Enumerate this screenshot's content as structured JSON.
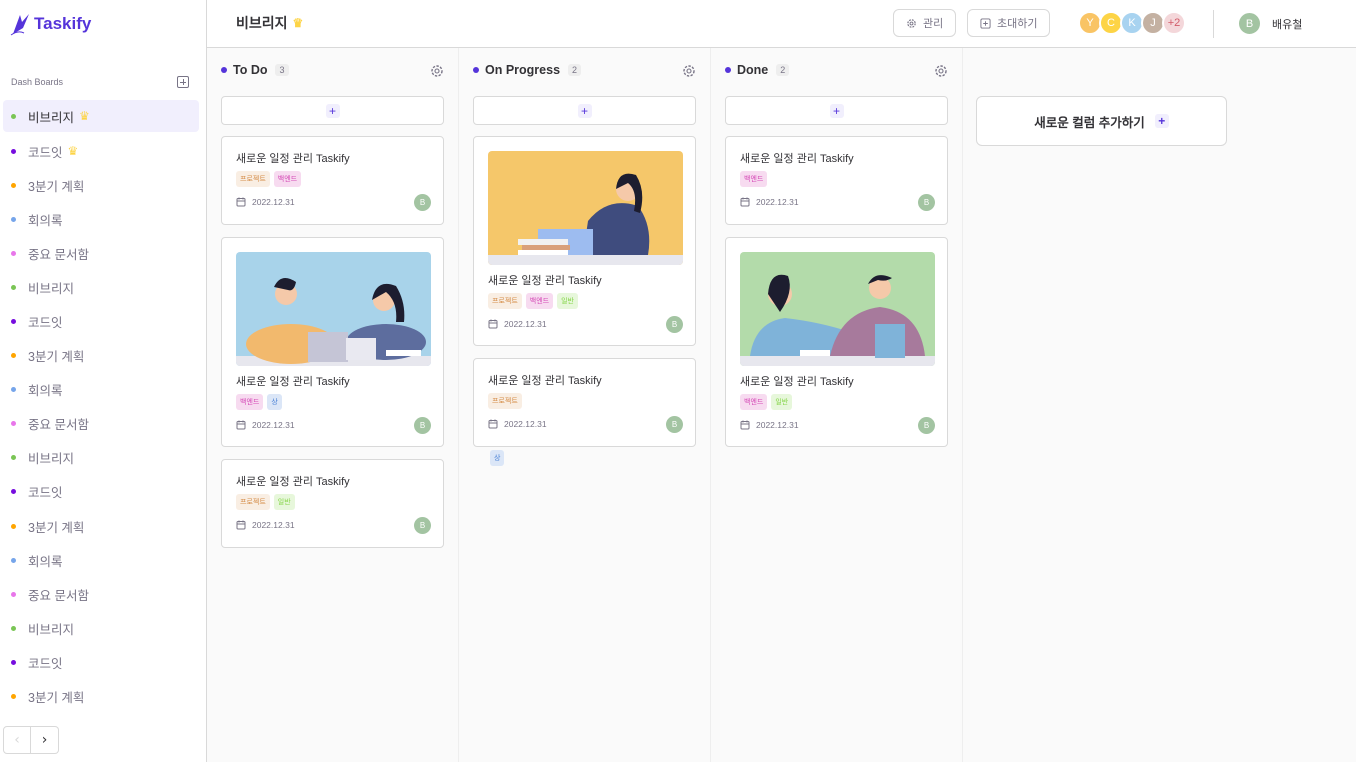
{
  "app": {
    "logo_text": "Taskify",
    "accent": "#5534DA"
  },
  "sidebar": {
    "title": "Dash Boards",
    "items": [
      {
        "label": "비브리지",
        "color": "#7ac555",
        "crown": true,
        "active": true
      },
      {
        "label": "코드잇",
        "color": "#760dde",
        "crown": true
      },
      {
        "label": "3분기 계획",
        "color": "#ffa500"
      },
      {
        "label": "회의록",
        "color": "#76a5ea"
      },
      {
        "label": "중요 문서함",
        "color": "#e876ea"
      },
      {
        "label": "비브리지",
        "color": "#7ac555"
      },
      {
        "label": "코드잇",
        "color": "#760dde"
      },
      {
        "label": "3분기 계획",
        "color": "#ffa500"
      },
      {
        "label": "회의록",
        "color": "#76a5ea"
      },
      {
        "label": "중요 문서함",
        "color": "#e876ea"
      },
      {
        "label": "비브리지",
        "color": "#7ac555"
      },
      {
        "label": "코드잇",
        "color": "#760dde"
      },
      {
        "label": "3분기 계획",
        "color": "#ffa500"
      },
      {
        "label": "회의록",
        "color": "#76a5ea"
      },
      {
        "label": "중요 문서함",
        "color": "#e876ea"
      },
      {
        "label": "비브리지",
        "color": "#7ac555"
      },
      {
        "label": "코드잇",
        "color": "#760dde"
      },
      {
        "label": "3분기 계획",
        "color": "#ffa500"
      }
    ],
    "pager": {
      "prev": "‹",
      "next": "›"
    }
  },
  "header": {
    "board_title": "비브리지",
    "manage_label": "관리",
    "invite_label": "초대하기",
    "members": [
      {
        "initial": "Y",
        "color": "#f9c465"
      },
      {
        "initial": "C",
        "color": "#fdd446"
      },
      {
        "initial": "K",
        "color": "#a8d3f0"
      },
      {
        "initial": "J",
        "color": "#c4b1a2"
      }
    ],
    "more_members": "+2",
    "user": {
      "initial": "B",
      "name": "배유철",
      "color": "#a3c4a2"
    }
  },
  "columns": [
    {
      "title": "To Do",
      "count": "3",
      "cards": [
        {
          "title": "새로운 일정 관리 Taskify",
          "tags": [
            {
              "label": "프로젝트",
              "kind": "proj"
            },
            {
              "label": "백엔드",
              "kind": "back"
            }
          ],
          "date": "2022.12.31",
          "assignee": "B",
          "image": null
        },
        {
          "title": "새로운 일정 관리 Taskify",
          "tags": [
            {
              "label": "백엔드",
              "kind": "back"
            },
            {
              "label": "상",
              "kind": "high"
            }
          ],
          "date": "2022.12.31",
          "assignee": "B",
          "image": "two-people-reading"
        },
        {
          "title": "새로운 일정 관리 Taskify",
          "tags": [
            {
              "label": "프로젝트",
              "kind": "proj"
            },
            {
              "label": "일반",
              "kind": "gen"
            }
          ],
          "date": "2022.12.31",
          "assignee": "B",
          "image": null
        }
      ]
    },
    {
      "title": "On Progress",
      "count": "2",
      "cards": [
        {
          "title": "새로운 일정 관리 Taskify",
          "tags": [
            {
              "label": "프로젝트",
              "kind": "proj"
            },
            {
              "label": "백엔드",
              "kind": "back"
            },
            {
              "label": "일반",
              "kind": "gen"
            }
          ],
          "date": "2022.12.31",
          "assignee": "B",
          "image": "woman-laptop"
        },
        {
          "title": "새로운 일정 관리 Taskify",
          "tags": [
            {
              "label": "프로젝트",
              "kind": "proj"
            }
          ],
          "date": "2022.12.31",
          "assignee": "B",
          "image": null
        }
      ],
      "stray_tag": {
        "label": "상",
        "kind": "high"
      }
    },
    {
      "title": "Done",
      "count": "2",
      "cards": [
        {
          "title": "새로운 일정 관리 Taskify",
          "tags": [
            {
              "label": "백엔드",
              "kind": "back"
            }
          ],
          "date": "2022.12.31",
          "assignee": "B",
          "image": null
        },
        {
          "title": "새로운 일정 관리 Taskify",
          "tags": [
            {
              "label": "백엔드",
              "kind": "back"
            },
            {
              "label": "일반",
              "kind": "gen"
            }
          ],
          "date": "2022.12.31",
          "assignee": "B",
          "image": "two-people-book"
        }
      ]
    }
  ],
  "new_column_label": "새로운 컬럼 추가하기"
}
